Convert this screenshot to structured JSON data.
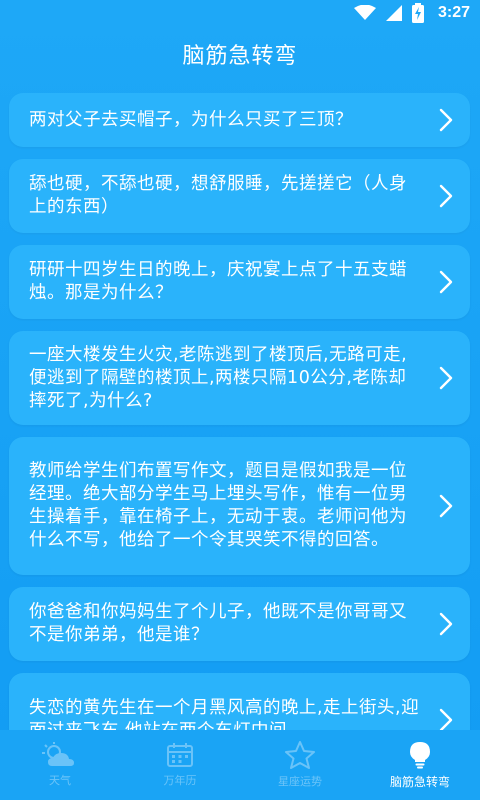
{
  "status_bar": {
    "time": "3:27"
  },
  "header": {
    "title": "脑筋急转弯"
  },
  "cards": [
    {
      "text": "两对父子去买帽子，为什么只买了三顶？"
    },
    {
      "text": "舔也硬，不舔也硬，想舒服睡，先搓搓它（人身上的东西）"
    },
    {
      "text": "研研十四岁生日的晚上，庆祝宴上点了十五支蜡烛。那是为什么？"
    },
    {
      "text": "一座大楼发生火灾,老陈逃到了楼顶后,无路可走,便逃到了隔壁的楼顶上,两楼只隔10公分,老陈却摔死了,为什么?"
    },
    {
      "text": "教师给学生们布置写作文，题目是假如我是一位经理。绝大部分学生马上埋头写作，惟有一位男生操着手，靠在椅子上，无动于衷。老师问他为什么不写，他给了一个令其哭笑不得的回答。"
    },
    {
      "text": "你爸爸和你妈妈生了个儿子，他既不是你哥哥又不是你弟弟，他是谁？"
    },
    {
      "text": "失恋的黄先生在一个月黑风高的晚上,走上街头,迎面过来飞车,他站在两个车灯中间,"
    }
  ],
  "bottom_nav": {
    "items": [
      {
        "label": "天气",
        "icon": "weather-icon",
        "active": false
      },
      {
        "label": "万年历",
        "icon": "calendar-icon",
        "active": false
      },
      {
        "label": "星座运势",
        "icon": "star-icon",
        "active": false
      },
      {
        "label": "脑筋急转弯",
        "icon": "lightbulb-icon",
        "active": true
      }
    ]
  },
  "colors": {
    "background": "#129cf3",
    "card": "#2ab3fb",
    "text": "#ffffff"
  }
}
